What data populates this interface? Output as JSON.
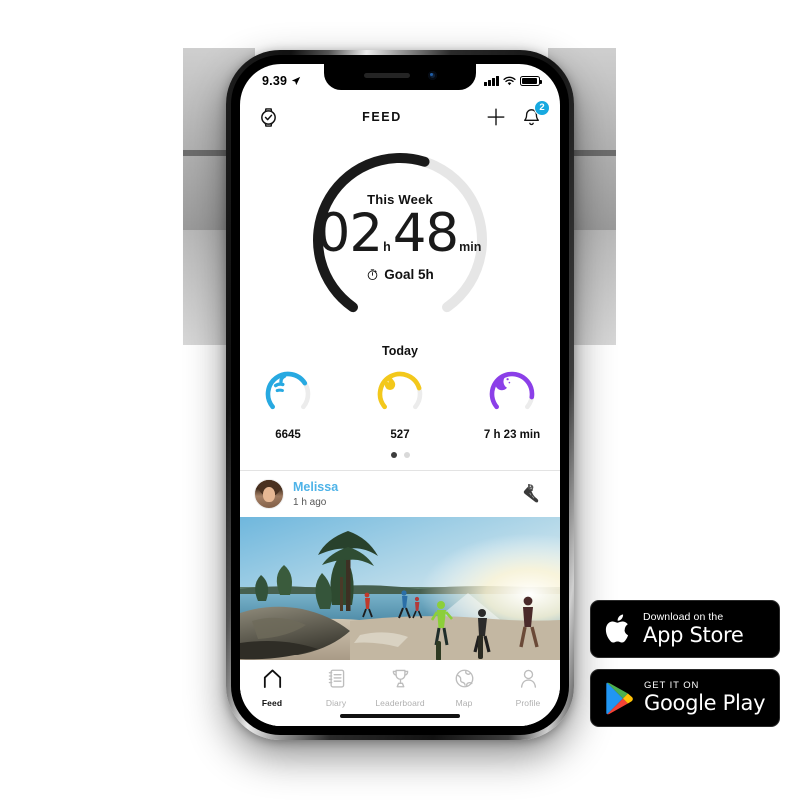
{
  "status_bar": {
    "time": "9.39",
    "location_icon": "location-arrow-icon",
    "signal_icon": "cellular-signal-icon",
    "wifi_icon": "wifi-icon",
    "battery_icon": "battery-icon"
  },
  "navbar": {
    "watch_icon": "watch-icon",
    "title": "FEED",
    "add_icon": "plus-icon",
    "bell_icon": "bell-icon",
    "notification_count": "2"
  },
  "week_ring": {
    "label": "This Week",
    "hours": "02",
    "hours_unit": "h",
    "minutes": "48",
    "minutes_unit": "min",
    "goal_icon": "stopwatch-icon",
    "goal_text": "Goal 5h",
    "progress_percent": 56,
    "track_color": "#e6e6e6",
    "progress_color": "#1a1a1a"
  },
  "today": {
    "label": "Today",
    "metrics": [
      {
        "name": "steps",
        "icon": "steps-icon",
        "value": "6645",
        "color": "#27A9E1",
        "percent": 72
      },
      {
        "name": "calories",
        "icon": "flame-icon",
        "value": "527",
        "color": "#F3C81B",
        "percent": 78
      },
      {
        "name": "sleep",
        "icon": "moon-icon",
        "value": "7 h 23 min",
        "color": "#8B3FE8",
        "percent": 88
      }
    ],
    "pager": {
      "total": 2,
      "active": 1
    }
  },
  "feed_post": {
    "avatar": "user-avatar",
    "username": "Melissa",
    "timestamp": "1 h ago",
    "activity_icon": "running-shoe-icon",
    "photo_alt": "runners-on-lakeside-beach-at-sunset"
  },
  "tabbar": {
    "items": [
      {
        "name": "feed",
        "icon": "home-icon",
        "label": "Feed",
        "active": true
      },
      {
        "name": "diary",
        "icon": "notebook-icon",
        "label": "Diary",
        "active": false
      },
      {
        "name": "leaderboard",
        "icon": "trophy-icon",
        "label": "Leaderboard",
        "active": false
      },
      {
        "name": "map",
        "icon": "globe-icon",
        "label": "Map",
        "active": false
      },
      {
        "name": "profile",
        "icon": "person-icon",
        "label": "Profile",
        "active": false
      }
    ]
  },
  "store_badges": {
    "apple": {
      "icon": "apple-logo-icon",
      "small": "Download on the",
      "big": "App Store"
    },
    "google": {
      "icon": "google-play-logo-icon",
      "small": "GET IT ON",
      "big": "Google Play"
    }
  }
}
